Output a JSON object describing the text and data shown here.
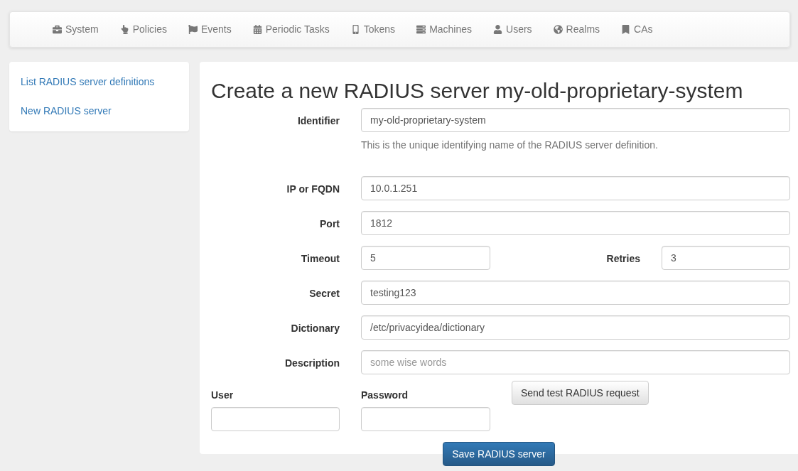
{
  "nav": [
    {
      "label": "System"
    },
    {
      "label": "Policies"
    },
    {
      "label": "Events"
    },
    {
      "label": "Periodic Tasks"
    },
    {
      "label": "Tokens"
    },
    {
      "label": "Machines"
    },
    {
      "label": "Users"
    },
    {
      "label": "Realms"
    },
    {
      "label": "CAs"
    }
  ],
  "sidebar": {
    "items": [
      {
        "label": "List RADIUS server definitions"
      },
      {
        "label": "New RADIUS server"
      }
    ]
  },
  "form": {
    "title": "Create a new RADIUS server my-old-proprietary-system",
    "rows": [
      {
        "kind": "single",
        "fields": [
          {
            "label": "Identifier",
            "value": "my-old-proprietary-system",
            "help": "This is the unique identifying name of the RADIUS server definition."
          }
        ]
      },
      {
        "kind": "single",
        "fields": [
          {
            "label": "IP or FQDN",
            "value": "10.0.1.251"
          }
        ]
      },
      {
        "kind": "single",
        "fields": [
          {
            "label": "Port",
            "value": "1812"
          }
        ]
      },
      {
        "kind": "pair",
        "fields": [
          {
            "label": "Timeout",
            "value": "5"
          },
          {
            "label": "Retries",
            "value": "3"
          }
        ]
      },
      {
        "kind": "single",
        "fields": [
          {
            "label": "Secret",
            "value": "testing123"
          }
        ]
      },
      {
        "kind": "single",
        "fields": [
          {
            "label": "Dictionary",
            "value": "/etc/privacyidea/dictionary"
          }
        ]
      },
      {
        "kind": "single",
        "fields": [
          {
            "label": "Description",
            "placeholder": "some wise words"
          }
        ]
      }
    ],
    "test": {
      "user_label": "User",
      "password_label": "Password",
      "button": "Send test RADIUS request"
    },
    "save_button": "Save RADIUS server"
  }
}
